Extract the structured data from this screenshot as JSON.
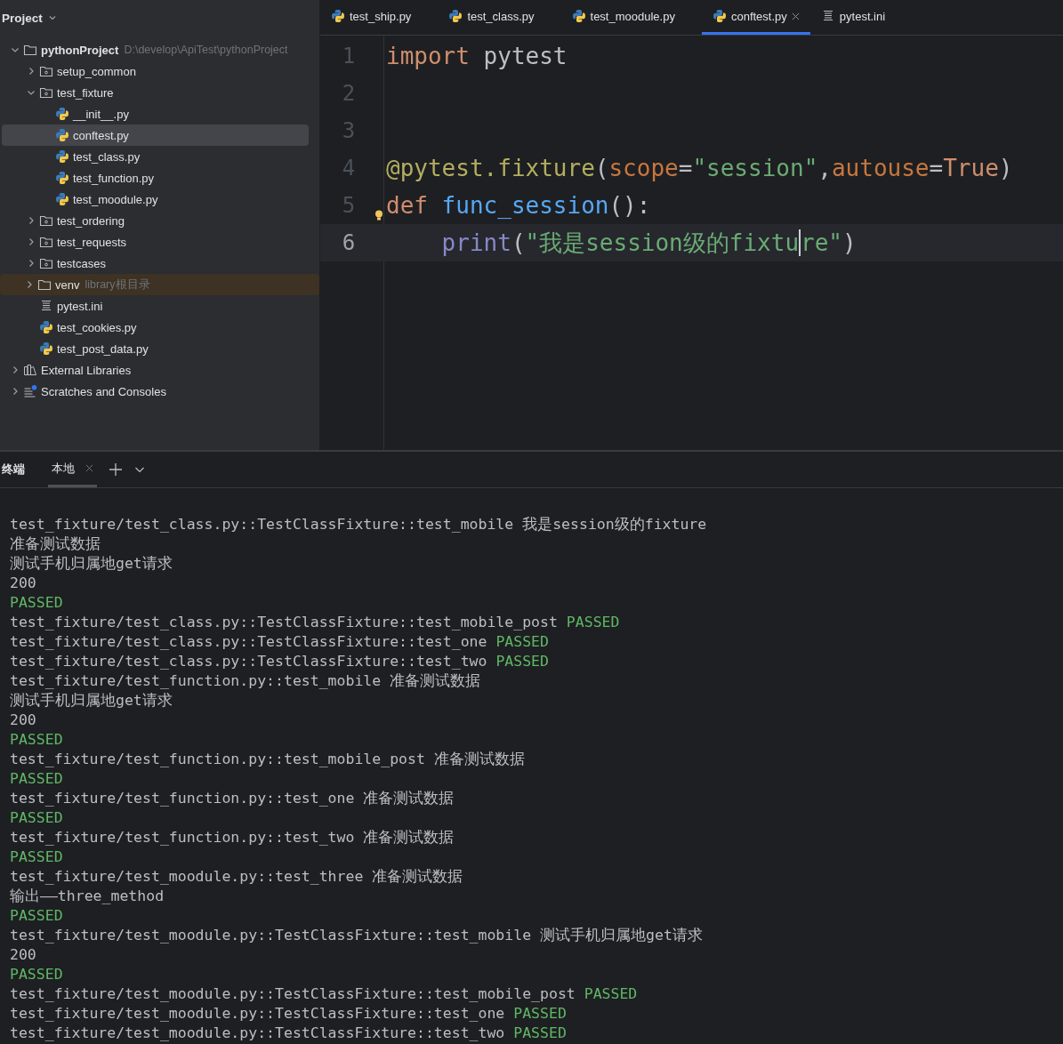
{
  "sidebar": {
    "title": "Project",
    "tree": [
      {
        "label": "pythonProject",
        "hint": "D:\\develop\\ApiTest\\pythonProject",
        "kind": "root",
        "expanded": true,
        "selected": false,
        "children": [
          {
            "label": "setup_common",
            "kind": "package",
            "expanded": false,
            "selected": false
          },
          {
            "label": "test_fixture",
            "kind": "package",
            "expanded": true,
            "selected": false,
            "children": [
              {
                "label": "__init__.py",
                "kind": "python",
                "selected": false
              },
              {
                "label": "conftest.py",
                "kind": "python",
                "selected": true
              },
              {
                "label": "test_class.py",
                "kind": "python",
                "selected": false
              },
              {
                "label": "test_function.py",
                "kind": "python",
                "selected": false
              },
              {
                "label": "test_moodule.py",
                "kind": "python",
                "selected": false
              }
            ]
          },
          {
            "label": "test_ordering",
            "kind": "package",
            "expanded": false,
            "selected": false
          },
          {
            "label": "test_requests",
            "kind": "package",
            "expanded": false,
            "selected": false
          },
          {
            "label": "testcases",
            "kind": "package",
            "expanded": false,
            "selected": false
          },
          {
            "label": "venv",
            "hint": "library根目录",
            "kind": "excluded",
            "expanded": false,
            "selected": false
          },
          {
            "label": "pytest.ini",
            "kind": "text",
            "selected": false
          },
          {
            "label": "test_cookies.py",
            "kind": "python",
            "selected": false
          },
          {
            "label": "test_post_data.py",
            "kind": "python",
            "selected": false
          }
        ]
      },
      {
        "label": "External Libraries",
        "kind": "libraries",
        "expanded": false,
        "selected": false
      },
      {
        "label": "Scratches and Consoles",
        "kind": "scratches",
        "expanded": false,
        "selected": false
      }
    ]
  },
  "editor": {
    "tabs": [
      {
        "label": "test_ship.py",
        "kind": "python",
        "selected": false
      },
      {
        "label": "test_class.py",
        "kind": "python",
        "selected": false
      },
      {
        "label": "test_moodule.py",
        "kind": "python",
        "selected": false
      },
      {
        "label": "conftest.py",
        "kind": "python",
        "selected": true
      },
      {
        "label": "pytest.ini",
        "kind": "text",
        "selected": false
      }
    ],
    "lines": [
      {
        "number": "1",
        "current": false,
        "tokens": [
          {
            "text": "import",
            "kind": "keyword"
          },
          {
            "text": " pytest",
            "kind": "plain"
          }
        ]
      },
      {
        "number": "2",
        "current": false
      },
      {
        "number": "3",
        "current": false
      },
      {
        "number": "4",
        "current": false,
        "tokens": [
          {
            "text": "@pytest.fixture",
            "kind": "decorator"
          },
          {
            "text": "(",
            "kind": "plain"
          },
          {
            "text": "scope",
            "kind": "param"
          },
          {
            "text": "=",
            "kind": "plain"
          },
          {
            "text": "\"session\"",
            "kind": "string"
          },
          {
            "text": ",",
            "kind": "plain"
          },
          {
            "text": "autouse",
            "kind": "param"
          },
          {
            "text": "=",
            "kind": "plain"
          },
          {
            "text": "True",
            "kind": "keyword"
          },
          {
            "text": ")",
            "kind": "plain"
          }
        ]
      },
      {
        "number": "5",
        "current": false,
        "bulb": true,
        "tokens": [
          {
            "text": "def",
            "kind": "keyword"
          },
          {
            "text": " func_session",
            "kind": "function"
          },
          {
            "text": "():",
            "kind": "plain"
          }
        ]
      },
      {
        "number": "6",
        "current": true,
        "indented": true,
        "tokens": [
          {
            "text": "print",
            "kind": "builtin"
          },
          {
            "text": "(",
            "kind": "plain"
          },
          {
            "text": "\"我是session级的fixtu",
            "kind": "string",
            "caret_after": true
          },
          {
            "text": "re\"",
            "kind": "string"
          },
          {
            "text": ")",
            "kind": "plain"
          }
        ]
      }
    ]
  },
  "terminal": {
    "title": "终端",
    "tabs": [
      {
        "label": "本地",
        "selected": true
      }
    ],
    "lines": [
      {
        "text": "test_fixture/test_class.py::TestClassFixture::test_mobile 我是session级的fixture"
      },
      {
        "text": "准备测试数据"
      },
      {
        "text": "测试手机归属地get请求"
      },
      {
        "text": "200"
      },
      {
        "result": "PASSED"
      },
      {
        "text": "test_fixture/test_class.py::TestClassFixture::test_mobile_post",
        "result": "PASSED"
      },
      {
        "text": "test_fixture/test_class.py::TestClassFixture::test_one",
        "result": "PASSED"
      },
      {
        "text": "test_fixture/test_class.py::TestClassFixture::test_two",
        "result": "PASSED"
      },
      {
        "text": "test_fixture/test_function.py::test_mobile 准备测试数据"
      },
      {
        "text": "测试手机归属地get请求"
      },
      {
        "text": "200"
      },
      {
        "result": "PASSED"
      },
      {
        "text": "test_fixture/test_function.py::test_mobile_post 准备测试数据"
      },
      {
        "result": "PASSED"
      },
      {
        "text": "test_fixture/test_function.py::test_one 准备测试数据"
      },
      {
        "result": "PASSED"
      },
      {
        "text": "test_fixture/test_function.py::test_two 准备测试数据"
      },
      {
        "result": "PASSED"
      },
      {
        "text": "test_fixture/test_moodule.py::test_three 准备测试数据"
      },
      {
        "text": "输出——three_method"
      },
      {
        "result": "PASSED"
      },
      {
        "text": "test_fixture/test_moodule.py::TestClassFixture::test_mobile 测试手机归属地get请求"
      },
      {
        "text": "200"
      },
      {
        "result": "PASSED"
      },
      {
        "text": "test_fixture/test_moodule.py::TestClassFixture::test_mobile_post",
        "result": "PASSED"
      },
      {
        "text": "test_fixture/test_moodule.py::TestClassFixture::test_one",
        "result": "PASSED"
      },
      {
        "text": "test_fixture/test_moodule.py::TestClassFixture::test_two",
        "result": "PASSED"
      }
    ]
  }
}
